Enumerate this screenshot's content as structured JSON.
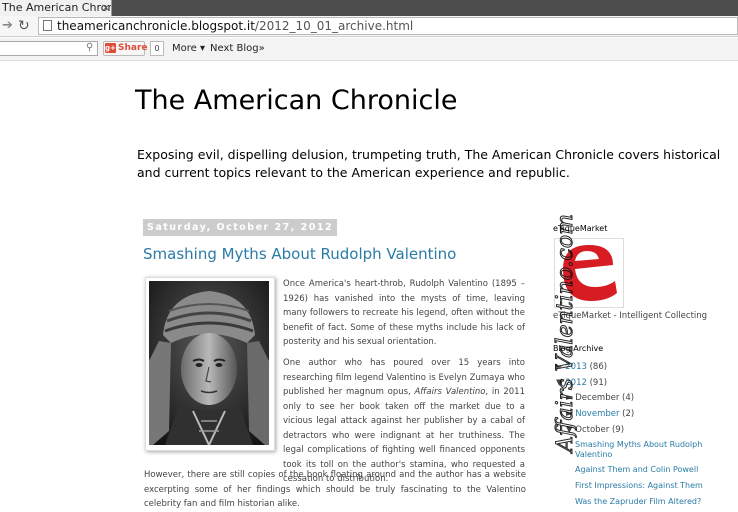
{
  "browser": {
    "tab_title": "The American Chroni",
    "tab_close": "×",
    "url_host": "theamericanchronicle.blogspot.it",
    "url_path": "/2012_10_01_archive.html"
  },
  "navbar": {
    "share_label": "Share",
    "share_count": "0",
    "more_label": "More ▾",
    "next_blog_label": "Next Blog»"
  },
  "blog": {
    "title": "The American Chronicle",
    "description": "Exposing evil, dispelling delusion, trumpeting truth, The American Chronicle covers historical and current topics relevant to the American experience and republic."
  },
  "post": {
    "date_header": "Saturday, October 27, 2012",
    "title": "Smashing Myths About Rudolph Valentino",
    "para1": "Once America's heart-throb, Rudolph Valentino (1895 – 1926) has vanished into the mysts of time, leaving many followers to recreate his legend, often without the benefit of fact. Some of these myths include his lack of posterity and his sexual orientation.",
    "para2_before": "One author who has poured over 15 years into researching film legend Valentino is Evelyn Zumaya who published her magnum opus, ",
    "para2_book": "Affairs Valentino",
    "para2_after": ", in 2011 only to see her book taken off the market due to a vicious legal attack against her publisher by a cabal of detractors who were indignant at her truthiness. The legal complications of fighting well financed opponents took its toll on the author's stamina, who requested a cessation to distribution.",
    "para3": "However, there are still copies of the book floating around and the author has a website excerpting some of her findings which should be truly fascinating to the Valentino celebrity fan and film historian alike."
  },
  "sidebar": {
    "etique_title": "eTiqueMarket",
    "etique_caption": "eTiqueMarket - Intelligent Collecting",
    "archive_title": "Blog Archive",
    "years": [
      {
        "label": "2013",
        "count": "(86)"
      },
      {
        "label": "2012",
        "count": "(91)"
      }
    ],
    "months": [
      {
        "label": "December",
        "count": "(4)"
      },
      {
        "label": "November",
        "count": "(2)"
      },
      {
        "label": "October",
        "count": "(9)"
      }
    ],
    "posts": [
      "Smashing Myths About Rudolph Valentino",
      "Against Them and Colin Powell",
      "First Impressions: Against Them",
      "Was the Zapruder Film Altered?"
    ]
  },
  "watermark": "Affairs Valentino.com"
}
